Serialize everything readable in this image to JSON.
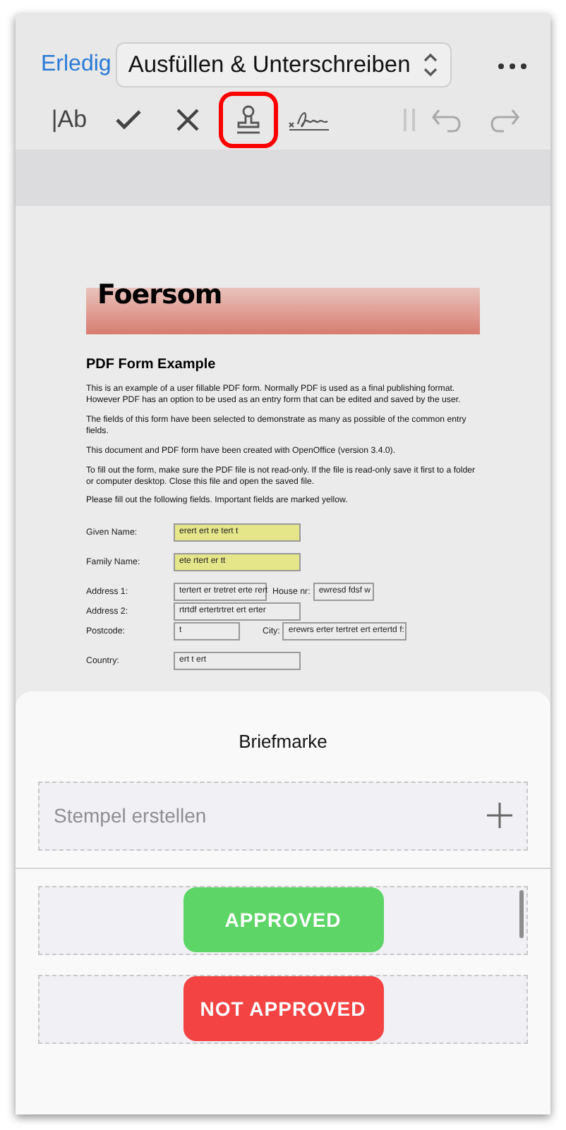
{
  "nav": {
    "done": "Erledig",
    "mode": "Ausfüllen & Unterschreiben"
  },
  "tools": [
    {
      "kind": "text",
      "label": "|Ab",
      "selected": false
    },
    {
      "kind": "check",
      "selected": false
    },
    {
      "kind": "cross",
      "selected": false
    },
    {
      "kind": "stamp",
      "selected": true
    },
    {
      "kind": "signature",
      "selected": false
    }
  ],
  "history": [
    {
      "kind": "undo",
      "disabled": true
    },
    {
      "kind": "redo",
      "disabled": true
    }
  ],
  "document": {
    "logo": "Foersom",
    "title": "PDF Form Example",
    "paragraphs": [
      "This is an example of a user fillable PDF form. Normally PDF is used as a final publishing format. However PDF has an option to be used as an entry form that can be edited and saved by the user.",
      "The fields of this form have been selected to demonstrate as many as possible of the common entry fields.",
      "This document and PDF form have been created with OpenOffice (version 3.4.0).",
      "To fill out the form, make sure the PDF file is not read-only. If the file is read-only save it first to a folder or computer desktop. Close this file and open the saved file.",
      "Please fill out the following fields. Important fields are marked yellow."
    ],
    "fields": [
      {
        "kind": "single",
        "label": "Given Name:",
        "value": "erert ert re tert t",
        "important": true
      },
      {
        "kind": "single",
        "label": "Family Name:",
        "value": "ete rtert er tt",
        "important": true
      },
      {
        "kind": "pair",
        "label": "Address 1:",
        "value": "tertert er tretret  erte rert",
        "label_2": "House nr:",
        "value_2": "ewresd fdsf w",
        "important": false
      },
      {
        "kind": "single",
        "label": "Address 2:",
        "value": "rtrtdf ertertrtret ert erter",
        "important": false
      },
      {
        "kind": "pair",
        "label": "Postcode:",
        "value": "t",
        "label_2": "City:",
        "value_2": "erewrs erter tertret ert ertertd f:",
        "important": false
      },
      {
        "kind": "single",
        "label": "Country:",
        "value": "ert t ert",
        "important": false
      }
    ]
  },
  "sheet": {
    "title": "Briefmarke",
    "create": "Stempel erstellen",
    "stamps": [
      {
        "label": "APPROVED",
        "color": "#5ed567"
      },
      {
        "label": "NOT APPROVED",
        "color": "#f34343"
      }
    ]
  }
}
